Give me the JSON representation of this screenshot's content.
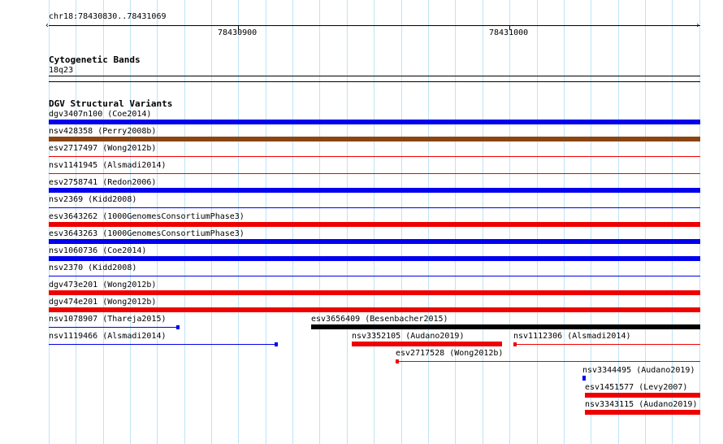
{
  "ruler": {
    "location": "chr18:78430830..78431069",
    "tick_labels": [
      "78430900",
      "78431000"
    ]
  },
  "cytoband_track": {
    "title": "Cytogenetic Bands",
    "band": "18q23"
  },
  "dgv_track": {
    "title": "DGV Structural Variants"
  },
  "colors": {
    "blue": "#0000ee",
    "brown": "#8b4513",
    "red": "#ee0000",
    "black": "#000000",
    "grid": "#bfe4f5"
  },
  "variants": [
    {
      "label": "dgv3407n100 (Coe2014)",
      "color": "blue",
      "style": "thick"
    },
    {
      "label": "nsv428358 (Perry2008b)",
      "color": "brown",
      "style": "thick"
    },
    {
      "label": "esv2717497 (Wong2012b)",
      "color": "red",
      "style": "thin"
    },
    {
      "label": "nsv1141945 (Alsmadi2014)",
      "color": "red",
      "style": "thin"
    },
    {
      "label": "esv2758741 (Redon2006)",
      "color": "blue",
      "style": "thick"
    },
    {
      "label": "nsv2369 (Kidd2008)",
      "color": "blue",
      "style": "thin"
    },
    {
      "label": "esv3643262 (1000GenomesConsortiumPhase3)",
      "color": "red",
      "style": "thick"
    },
    {
      "label": "esv3643263 (1000GenomesConsortiumPhase3)",
      "color": "blue",
      "style": "thick"
    },
    {
      "label": "nsv1060736 (Coe2014)",
      "color": "blue",
      "style": "thick"
    },
    {
      "label": "nsv2370 (Kidd2008)",
      "color": "blue",
      "style": "thin"
    },
    {
      "label": "dgv473e201 (Wong2012b)",
      "color": "red",
      "style": "thick"
    },
    {
      "label": "dgv474e201 (Wong2012b)",
      "color": "red",
      "style": "thick"
    },
    {
      "label": "nsv1078907 (Thareja2015)",
      "color": "blue",
      "style": "thin-end"
    },
    {
      "label": "esv3656409 (Besenbacher2015)",
      "color": "black",
      "style": "thick"
    },
    {
      "label": "nsv1119466 (Alsmadi2014)",
      "color": "blue",
      "style": "thin-end"
    },
    {
      "label": "nsv3352105 (Audano2019)",
      "color": "red",
      "style": "thick"
    },
    {
      "label": "nsv1112306 (Alsmadi2014)",
      "color": "red",
      "style": "thin-start"
    },
    {
      "label": "esv2717528 (Wong2012b)",
      "color": "red",
      "style": "thin-start"
    },
    {
      "label": "nsv3344495 (Audano2019)",
      "color": "blue",
      "style": "point"
    },
    {
      "label": "esv1451577 (Levy2007)",
      "color": "red",
      "style": "thick"
    },
    {
      "label": "nsv3343115 (Audano2019)",
      "color": "red",
      "style": "thick"
    }
  ]
}
